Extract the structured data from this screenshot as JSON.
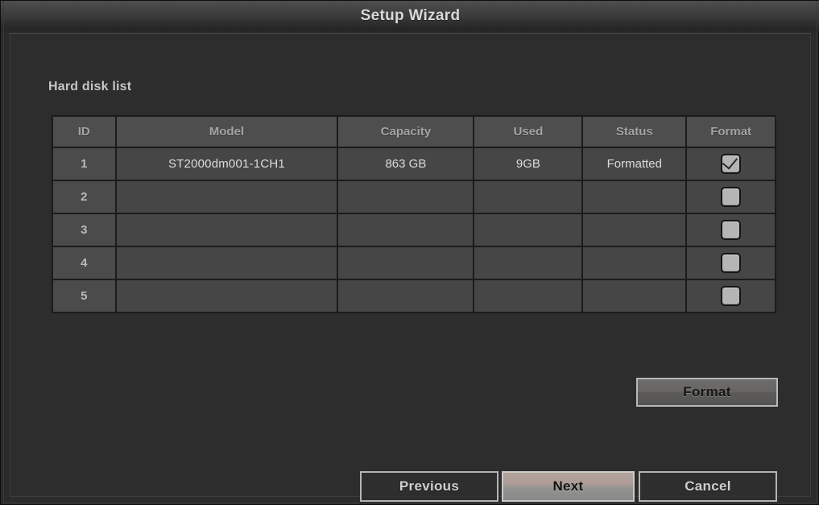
{
  "window": {
    "title": "Setup Wizard"
  },
  "main": {
    "section_label": "Hard disk list"
  },
  "table": {
    "columns": [
      {
        "key": "id",
        "label": "ID"
      },
      {
        "key": "model",
        "label": "Model"
      },
      {
        "key": "cap",
        "label": "Capacity"
      },
      {
        "key": "used",
        "label": "Used"
      },
      {
        "key": "status",
        "label": "Status"
      },
      {
        "key": "format",
        "label": "Format"
      }
    ],
    "rows": [
      {
        "id": "1",
        "model": "ST2000dm001-1CH1",
        "capacity": "863  GB",
        "used": "9GB",
        "status": "Formatted",
        "format_checked": true
      },
      {
        "id": "2",
        "model": "",
        "capacity": "",
        "used": "",
        "status": "",
        "format_checked": false
      },
      {
        "id": "3",
        "model": "",
        "capacity": "",
        "used": "",
        "status": "",
        "format_checked": false
      },
      {
        "id": "4",
        "model": "",
        "capacity": "",
        "used": "",
        "status": "",
        "format_checked": false
      },
      {
        "id": "5",
        "model": "",
        "capacity": "",
        "used": "",
        "status": "",
        "format_checked": false
      }
    ]
  },
  "buttons": {
    "format": "Format",
    "previous": "Previous",
    "next": "Next",
    "cancel": "Cancel"
  },
  "colors": {
    "window_bg": "#2d2d2d",
    "titlebar_top": "#4e4e4e",
    "cell_bg": "#464646",
    "header_bg": "#4e4e4e",
    "grid_line": "#1b1b1b",
    "text_primary": "#dcdcdc",
    "text_header": "#a3a3a3",
    "checkbox_fill": "#b5b5b5",
    "focus_button_top": "#b4a39c"
  }
}
